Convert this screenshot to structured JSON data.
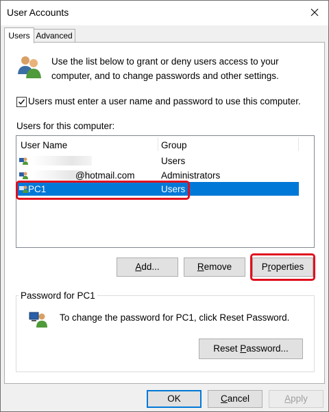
{
  "window": {
    "title": "User Accounts"
  },
  "tabs": [
    {
      "label": "Users"
    },
    {
      "label": "Advanced"
    }
  ],
  "intro": {
    "text": "Use the list below to grant or deny users access to your computer, and to change passwords and other settings."
  },
  "require_password": {
    "label": "Users must enter a user name and password to use this computer.",
    "checked": true
  },
  "users_list": {
    "label": "Users for this computer:",
    "columns": [
      "User Name",
      "Group"
    ],
    "rows": [
      {
        "user": "",
        "group": "Users",
        "selected": false
      },
      {
        "user": "@hotmail.com",
        "group": "Administrators",
        "selected": false
      },
      {
        "user": "PC1",
        "group": "Users",
        "selected": true
      }
    ]
  },
  "buttons": {
    "add": "Add...",
    "remove": "Remove",
    "properties": "Properties",
    "reset_password": "Reset Password...",
    "ok": "OK",
    "cancel": "Cancel",
    "apply": "Apply"
  },
  "password_group": {
    "title": "Password for PC1",
    "text": "To change the password for PC1, click Reset Password."
  },
  "colors": {
    "selection": "#0078d7",
    "highlight": "#e0101e"
  },
  "icons": [
    "users-icon",
    "user-icon",
    "close-icon",
    "check-icon"
  ]
}
